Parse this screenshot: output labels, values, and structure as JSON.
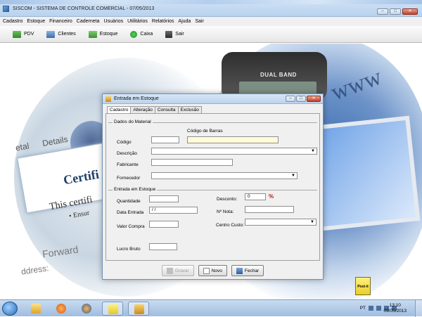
{
  "window": {
    "title": "SISCOM - SISTEMA DE CONTROLE COMERCIAL - 07/05/2013",
    "controls": [
      "–",
      "□",
      "✕"
    ]
  },
  "menu": [
    "Cadastro",
    "Estoque",
    "Financeiro",
    "Caderneta",
    "Usuários",
    "Utilitários",
    "Relatórios",
    "Ajuda",
    "Sair"
  ],
  "toolbar": {
    "pdv": "PDV",
    "clientes": "Clientes",
    "estoque": "Estoque",
    "caixa": "Caixa",
    "sair": "Sair"
  },
  "background": {
    "phone_brand": "DUAL BAND",
    "www": "www",
    "certificate": "Certifi",
    "certificate_line": "This certifi",
    "tab_metal": "etal",
    "tab_details": "Details",
    "forward": "Forward",
    "address": "ddress:",
    "ensure": "• Ensur"
  },
  "dialog": {
    "title": "Entrada em Estoque",
    "tabs": [
      "Cadastro",
      "Alteração",
      "Consulta",
      "Exclusão"
    ],
    "active_tab": "Cadastro",
    "material_group": "Dados do Material",
    "fields": {
      "codigo_label": "Código",
      "codigo_value": "",
      "codigo_barras_label": "Código de Barras",
      "codigo_barras_value": "",
      "descricao_label": "Descrição",
      "descricao_value": "",
      "fabricante_label": "Fabricante",
      "fabricante_value": "",
      "fornecedor_label": "Fornecedor",
      "fornecedor_value": ""
    },
    "entrada_group": "Entrada em Estoque",
    "entrada": {
      "quantidade_label": "Quantidade",
      "quantidade_value": "",
      "desconto_label": "Desconto:",
      "desconto_value": "0",
      "desconto_marker": "%",
      "data_entrada_label": "Data Entrada",
      "data_entrada_value": " / /",
      "nota_label": "Nº Nota:",
      "nota_value": "",
      "valor_compra_label": "Valor Compra",
      "valor_compra_value": "",
      "centro_custo_label": "Centro Custo:",
      "centro_custo_value": "",
      "lucro_bruto_label": "Lucro Bruto",
      "lucro_bruto_value": ""
    },
    "buttons": {
      "gravar": "Gravar",
      "novo": "Novo",
      "fechar": "Fechar"
    }
  },
  "desktop_icon": "Post-it",
  "taskbar": {
    "lang": "PT",
    "time": "13:10",
    "date": "09/05/2013"
  },
  "colors": {
    "title_bar": "#c4d9f1",
    "barcode_field": "#fffbd8",
    "required_marker": "#cc1111"
  }
}
